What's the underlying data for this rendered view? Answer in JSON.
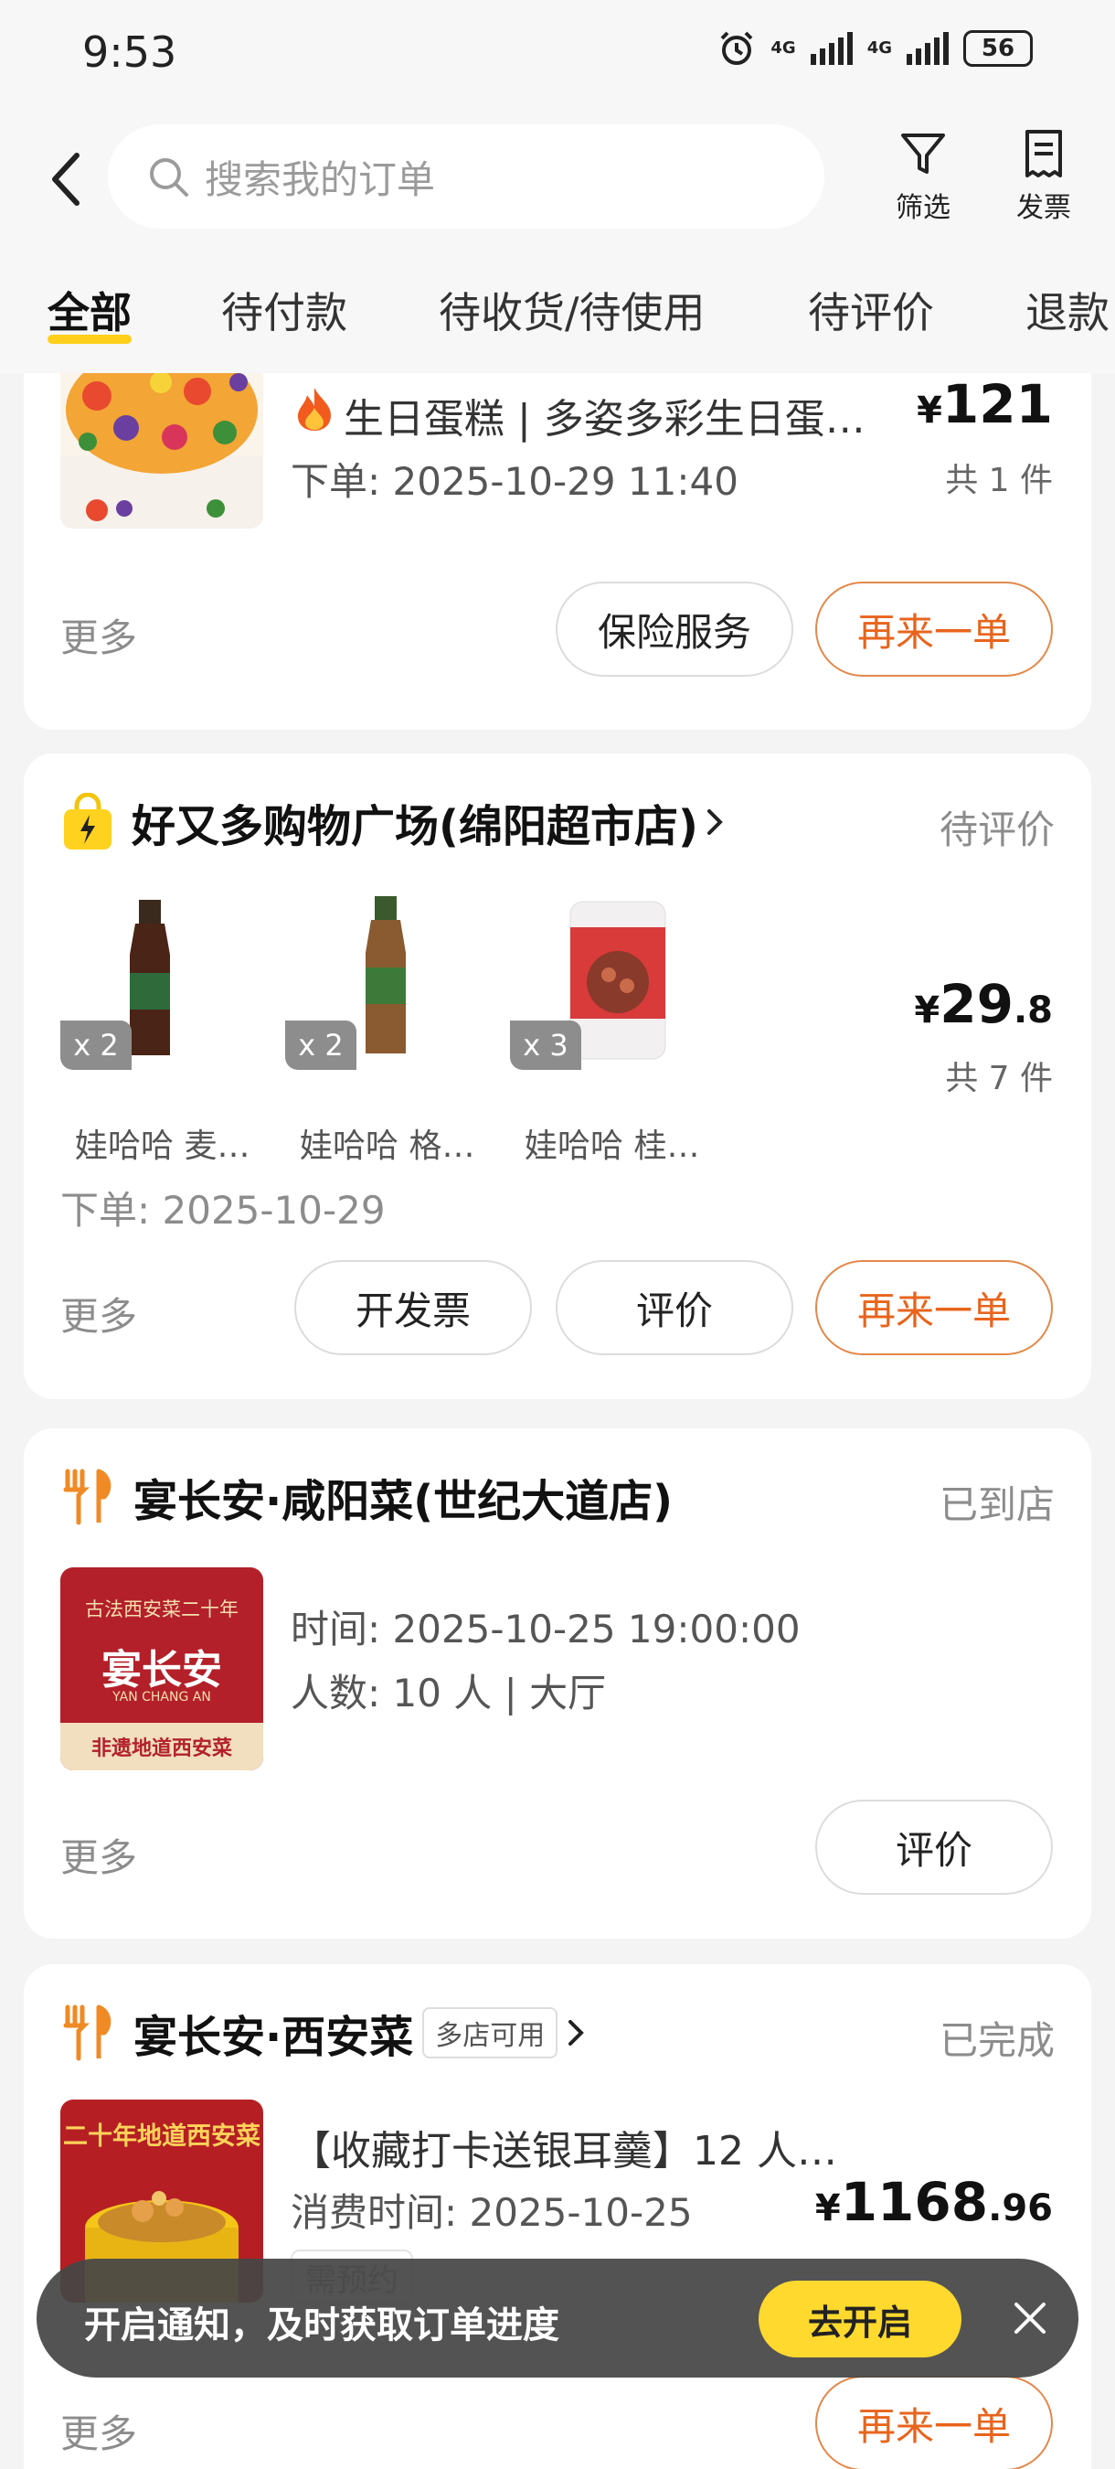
{
  "status_bar": {
    "time": "9:53",
    "network1": "4G",
    "network2": "4G",
    "battery": "56"
  },
  "header": {
    "search_placeholder": "搜索我的订单",
    "filter_label": "筛选",
    "invoice_label": "发票"
  },
  "tabs": [
    "全部",
    "待付款",
    "待收货/待使用",
    "待评价",
    "退款"
  ],
  "orders": [
    {
      "title": "生日蛋糕 | 多姿多彩生日蛋…",
      "order_time": "下单: 2025-10-29 11:40",
      "price_symbol": "¥",
      "price_int": "121",
      "price_dec": "",
      "count": "共 1 件",
      "more": "更多",
      "buttons": [
        "保险服务",
        "再来一单"
      ]
    },
    {
      "shop": "好又多购物广场(绵阳超市店)",
      "status": "待评价",
      "products": [
        {
          "qty": "x 2",
          "name": "娃哈哈 麦…"
        },
        {
          "qty": "x 2",
          "name": "娃哈哈 格…"
        },
        {
          "qty": "x 3",
          "name": "娃哈哈 桂…"
        }
      ],
      "price_symbol": "¥",
      "price_int": "29",
      "price_dec": ".8",
      "count": "共 7 件",
      "order_time": "下单: 2025-10-29",
      "more": "更多",
      "buttons": [
        "开发票",
        "评价",
        "再来一单"
      ]
    },
    {
      "shop": "宴长安·咸阳菜(世纪大道店)",
      "status": "已到店",
      "thumb_text_top": "古法西安菜二十年",
      "thumb_logo": "宴长安",
      "thumb_logo_en": "YAN CHANG AN",
      "thumb_text_bottom": "非遗地道西安菜",
      "time": "时间: 2025-10-25 19:00:00",
      "people": "人数: 10 人 | 大厅",
      "more": "更多",
      "buttons": [
        "评价"
      ]
    },
    {
      "shop": "宴长安·西安菜",
      "shop_tag": "多店可用",
      "status": "已完成",
      "thumb_text": "二十年地道西安菜",
      "title": "【收藏打卡送银耳羹】12 人…",
      "consume_time": "消费时间: 2025-10-25",
      "reserve_tag": "需预约",
      "price_symbol": "¥",
      "price_int": "1168",
      "price_dec": ".96",
      "more": "更多",
      "buttons": [
        "再来一单"
      ]
    }
  ],
  "toast": {
    "text": "开启通知，及时获取订单进度",
    "button": "去开启"
  },
  "colors": {
    "accent_yellow": "#ffcf1a",
    "primary_orange": "#e8641c",
    "background": "#f4f4f4"
  }
}
